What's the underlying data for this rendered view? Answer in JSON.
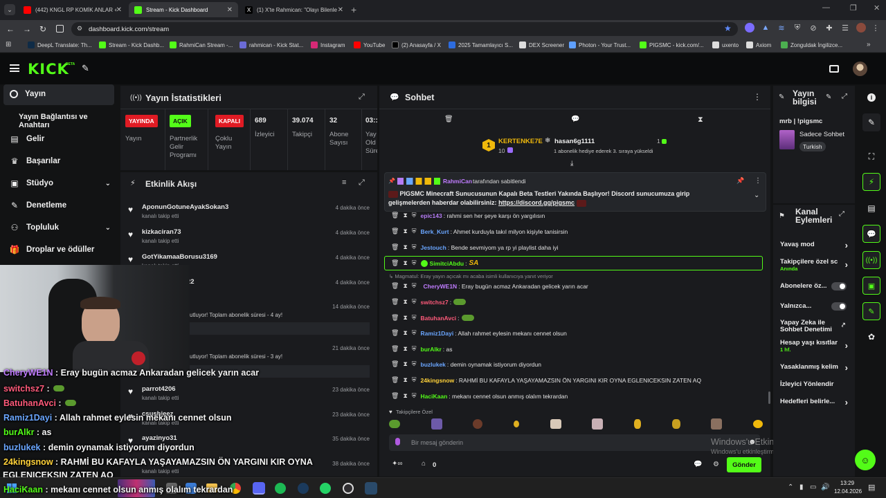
{
  "browser": {
    "tabs": [
      {
        "title": "(442) KNGL RP KOMİK ANLAR +"
      },
      {
        "title": "Stream - Kick Dashboard"
      },
      {
        "title": "(1) X'te Rahmican: \"Olayı Bilenle"
      }
    ],
    "url": "dashboard.kick.com/stream",
    "bookmarks": [
      "DeepL Translate: Th...",
      "Stream - Kick Dashb...",
      "RahmiCan Stream -...",
      "rahmican - Kick Stat...",
      "Instagram",
      "YouTube",
      "(2) Anasayfa / X",
      "2025 Tamamlayıcı S...",
      "DEX Screener",
      "Photon - Your Trust...",
      "PIGSMC - kick.com/...",
      "uxento",
      "Axiom",
      "Zonguldak İngilizce..."
    ]
  },
  "brand": {
    "logo": "KICK",
    "beta": "BETA"
  },
  "sidebar": {
    "items": [
      {
        "label": "Yayın"
      },
      {
        "label": "Yayın Bağlantısı ve Anahtarı"
      },
      {
        "label": "Gelir"
      },
      {
        "label": "Başarılar"
      },
      {
        "label": "Stüdyo"
      },
      {
        "label": "Denetleme"
      },
      {
        "label": "Topluluk"
      },
      {
        "label": "Droplar ve ödüller"
      }
    ]
  },
  "stats": {
    "title": "Yayın İstatistikleri",
    "cols": [
      {
        "badge": "YAYINDA",
        "label": "Yayın"
      },
      {
        "badge": "AÇIK",
        "label": "Partnerlik Gelir Programı"
      },
      {
        "badge": "KAPALI",
        "label": "Çoklu Yayın"
      },
      {
        "value": "689",
        "label": "İzleyici"
      },
      {
        "value": "39.074",
        "label": "Takipçi"
      },
      {
        "value": "32",
        "label": "Abone Sayısı"
      },
      {
        "value": "03::",
        "label": "Yay Old Süre"
      }
    ]
  },
  "feed": {
    "title": "Etkinlik Akışı",
    "items": [
      {
        "user": "AponunGotuneAyakSokan3",
        "action": "kanalı takip etti",
        "time": "4 dakika önce"
      },
      {
        "user": "kizkaciran73",
        "action": "kanalı takip etti",
        "time": "4 dakika önce"
      },
      {
        "user": "GotYikamaaBorusu3169",
        "action": "kanalı takip etti",
        "time": "4 dakika önce"
      },
      {
        "user": "22",
        "action": "",
        "time": "4 dakika önce"
      },
      {
        "user": "",
        "action": "kutluyor! Toplam abonelik süresi - 4 ay!",
        "time": "14 dakika önce"
      },
      {
        "user": "",
        "action": "kutluyor! Toplam abonelik süresi - 3 ay!",
        "time": "21 dakika önce"
      },
      {
        "user": "parrot4206",
        "action": "kanalı takip etti",
        "time": "23 dakika önce"
      },
      {
        "user": "csushieez",
        "action": "kanalı takip etti",
        "time": "23 dakika önce"
      },
      {
        "user": "ayazinyo31",
        "action": "kanalı takip etti",
        "time": "35 dakika önce"
      },
      {
        "user": "",
        "action": "kanalı takip etti",
        "time": "38 dakika önce"
      }
    ]
  },
  "chat": {
    "title": "Sohbet",
    "leader": {
      "user1": "KERTENKE7E",
      "count1": "10",
      "user2": "hasan6g1111",
      "count2": "1",
      "note": "1 abonelik hediye ederek 3. sıraya yükseldi",
      "rank": "1"
    },
    "pinned": {
      "by_user": "RahmiCan",
      "by_label": "tarafından sabitlendi",
      "text": "PIGSMC Minecraft Sunucusunun Kapalı Beta Testleri Yakında Başlıyor! Discord sunucumuza girip gelişmelerden haberdar olabilirsiniz:",
      "link": "https://discord.gg/pigsmc"
    },
    "messages": [
      {
        "user": "epic143",
        "color": "#b57cf5",
        "text": ": rahmi sen her şeye karşı ön yargılısın"
      },
      {
        "user": "Berk_Kurt",
        "color": "#6aa6ff",
        "text": ": Ahmet kurduyla takıl milyon kişiyle tanisirsin"
      },
      {
        "user": "Jestouch",
        "color": "#6aa6ff",
        "text": ": Bende sevmiyom ya rp yi playlist daha iyi"
      },
      {
        "user": "SimitciAbdu",
        "color": "#53fc18",
        "text": ":"
      },
      {
        "user": "CheryWE1N",
        "color": "#c07cff",
        "text": ": Eray bugün acmaz Ankaradan gelicek yarın acar"
      },
      {
        "user": "switchsz7",
        "color": "#ff5a7a",
        "text": ":"
      },
      {
        "user": "BatuhanAvci",
        "color": "#ff5a7a",
        "text": ":"
      },
      {
        "user": "Ramiz1Dayi",
        "color": "#6aa6ff",
        "text": ": Allah rahmet eylesin mekanı cennet olsun"
      },
      {
        "user": "burAlkr",
        "color": "#53fc18",
        "text": ": as"
      },
      {
        "user": "buzlukek",
        "color": "#6aa6ff",
        "text": ": demin oynamak istiyorum diyordun"
      },
      {
        "user": "24kingsnow",
        "color": "#ffd23a",
        "text": ": RAHMİ BU KAFAYLA YAŞAYAMAZSIN ÖN YARGINI KIR OYNA EGLENICEKSIN ZATEN AQ"
      },
      {
        "user": "HaciKaan",
        "color": "#53fc18",
        "text": ": mekanı cennet olsun anmış olalım tekrardan"
      }
    ],
    "reply_note": "Magmatul: Eray yayın açıcak mı acaba isimli kullanıcıya yanıt veriyor",
    "emote_label": "Takipçilere Özel",
    "input_placeholder": "Bir mesaj gönderin",
    "point_count": "0",
    "send": "Gönder"
  },
  "streaminfo": {
    "title": "Yayın bilgisi",
    "stream_title": "mrb | !pigsmc",
    "category": "Sadece Sohbet",
    "tag": "Turkish"
  },
  "channel": {
    "title": "Kanal Eylemleri",
    "rows": [
      {
        "label": "Yavaş mod",
        "sub": ""
      },
      {
        "label": "Takipçilere özel sc",
        "sub": "Anında"
      },
      {
        "label": "Abonelere öz...",
        "sub": ""
      },
      {
        "label": "Yalnızca...",
        "sub": ""
      },
      {
        "label": "Yapay Zeka ile Sohbet Denetimi",
        "sub": ""
      },
      {
        "label": "Hesap yaşı kısıtlar",
        "sub": "1 hf."
      },
      {
        "label": "Yasaklanmış kelim",
        "sub": ""
      },
      {
        "label": "İzleyici Yönlendir",
        "sub": ""
      },
      {
        "label": "Hedefleri belirle...",
        "sub": ""
      }
    ]
  },
  "overlay": {
    "lines": [
      {
        "user": "CheryWE1N",
        "text": " : Eray bugün acmaz Ankaradan gelicek yarın acar",
        "color": "#c07cff"
      },
      {
        "user": "switchsz7",
        "text": " :",
        "color": "#ff5a7a"
      },
      {
        "user": "BatuhanAvci",
        "text": " :",
        "color": "#ff5a7a"
      },
      {
        "user": "Ramiz1Dayi",
        "text": " : Allah rahmet eylesin mekanı cennet olsun",
        "color": "#6aa6ff"
      },
      {
        "user": "burAlkr",
        "text": " : as",
        "color": "#53fc18"
      },
      {
        "user": "buzlukek",
        "text": " : demin oynamak istiyorum diyordun",
        "color": "#6aa6ff"
      },
      {
        "user": "24kingsnow",
        "text": " : RAHMİ BU KAFAYLA YAŞAYAMAZSIN ÖN YARGINI KIR OYNA",
        "color": "#ffd23a"
      },
      {
        "user": "",
        "text": "EGLENICEKSIN ZATEN AQ",
        "color": "#ffd23a"
      },
      {
        "user": "HaciKaan",
        "text": " : mekanı cennet olsun anmış olalım tekrardan",
        "color": "#53fc18"
      }
    ]
  },
  "windows": {
    "line1": "Windows'u Etkinleştir",
    "line2": "Windows'u etkinleştirmek için Ayarlar'a gidin."
  },
  "taskbar": {
    "time": "13:29",
    "date": "12.04.2026"
  },
  "colors": {
    "accent": "#53fc18",
    "live": "#e01b24",
    "bg": "#121314",
    "panel": "#1a1b1e"
  }
}
